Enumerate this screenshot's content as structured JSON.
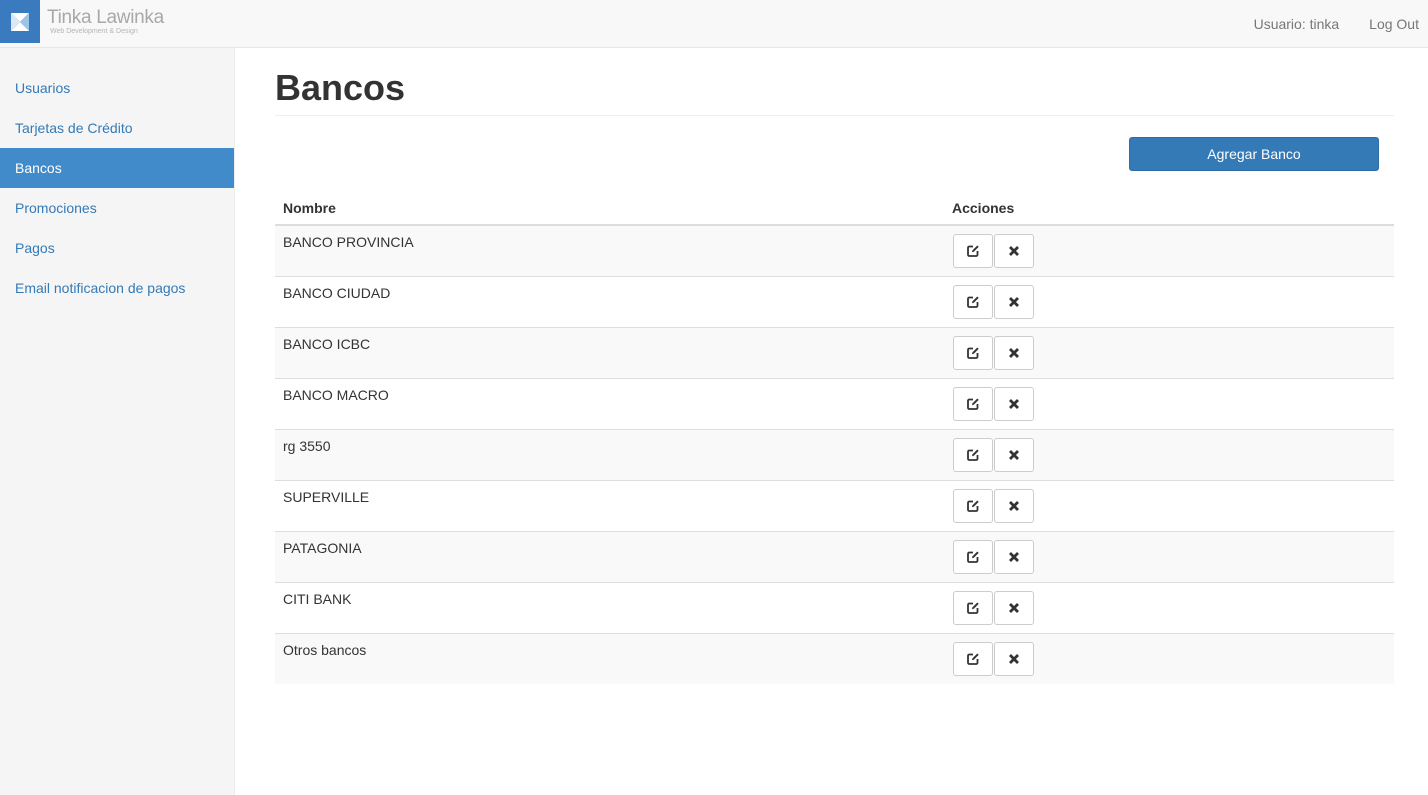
{
  "brand": {
    "name": "Tinka Lawinka",
    "tagline": "Web Development & Design",
    "accent": "#3a7bbf"
  },
  "nav": {
    "user_label": "Usuario: tinka",
    "logout_label": "Log Out"
  },
  "sidebar": {
    "items": [
      {
        "label": "Usuarios",
        "active": false
      },
      {
        "label": "Tarjetas de Crédito",
        "active": false
      },
      {
        "label": "Bancos",
        "active": true
      },
      {
        "label": "Promociones",
        "active": false
      },
      {
        "label": "Pagos",
        "active": false
      },
      {
        "label": "Email notificacion de pagos",
        "active": false
      }
    ],
    "active_color": "#428bca"
  },
  "main": {
    "title": "Bancos",
    "add_button_label": "Agregar Banco",
    "table": {
      "headers": [
        "Nombre",
        "Acciones"
      ],
      "rows": [
        {
          "name": "BANCO PROVINCIA"
        },
        {
          "name": "BANCO CIUDAD"
        },
        {
          "name": "BANCO ICBC"
        },
        {
          "name": "BANCO MACRO"
        },
        {
          "name": "rg 3550"
        },
        {
          "name": "SUPERVILLE"
        },
        {
          "name": "PATAGONIA"
        },
        {
          "name": "CITI BANK"
        },
        {
          "name": "Otros bancos"
        }
      ],
      "row_actions": [
        "edit-icon",
        "delete-icon"
      ]
    }
  }
}
